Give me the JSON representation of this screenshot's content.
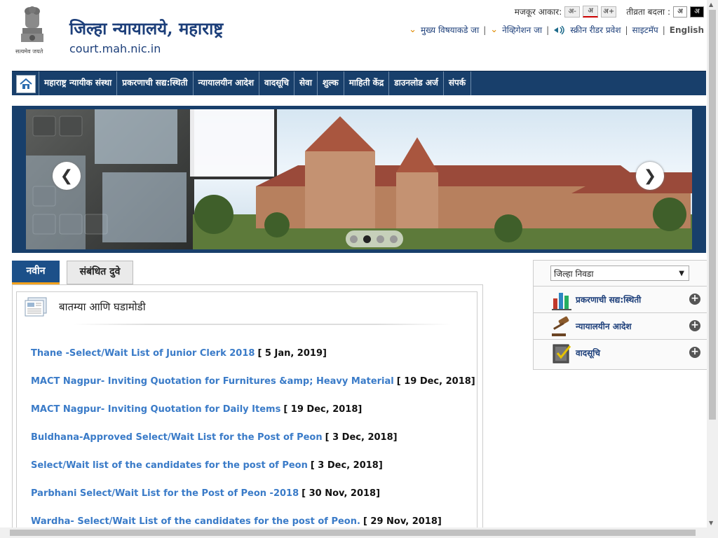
{
  "header": {
    "title": "जिल्हा न्यायालये, महाराष्ट्र",
    "url": "court.mah.nic.in",
    "emblem_caption": "सत्यमेव जयते",
    "text_size_label": "मजकूर आकार:",
    "text_sizes": [
      "अ-",
      "अ",
      "अ+"
    ],
    "contrast_label": "तीव्रता बदला :",
    "contrast_options": [
      "अ",
      "अ"
    ],
    "skip_to_main": "मुख्य विषयाकडे जा",
    "skip_to_nav": "नेव्हिगेशन जा",
    "screen_reader": "स्क्रीन रीडर प्रवेश",
    "sitemap": "साइटमॅप",
    "language": "English"
  },
  "nav": {
    "home_icon": "home-icon",
    "items": [
      "महाराष्ट्र न्यायीक संस्था",
      "प्रकरणाची सद्य:स्थिती",
      "न्यायालयीन आदेश",
      "वादसूचि",
      "सेवा",
      "शुल्क",
      "माहिती केंद्र",
      "डाउनलोड अर्ज",
      "संपर्क"
    ]
  },
  "slider": {
    "active_dot": 1,
    "dot_count": 4
  },
  "tabs": {
    "active": "नवीन",
    "inactive": "संबंधित दुवे"
  },
  "news": {
    "title": "बातम्या आणि घडामोडी",
    "items": [
      {
        "text": "Thane -Select/Wait List of Junior Clerk 2018",
        "date": "[ 5 Jan, 2019]"
      },
      {
        "text": "MACT Nagpur- Inviting Quotation for Furnitures &amp; Heavy Material",
        "date": "[ 19 Dec, 2018]"
      },
      {
        "text": "MACT Nagpur- Inviting Quotation for Daily Items",
        "date": "[ 19 Dec, 2018]"
      },
      {
        "text": "Buldhana-Approved Select/Wait List for the Post of Peon",
        "date": "[ 3 Dec, 2018]"
      },
      {
        "text": "Select/Wait list of the candidates for the post of Peon",
        "date": "[ 3 Dec, 2018]"
      },
      {
        "text": "Parbhani Select/Wait List for the Post of Peon -2018",
        "date": "[ 30 Nov, 2018]"
      },
      {
        "text": "Wardha- Select/Wait List of the candidates for the post of Peon.",
        "date": "[ 29 Nov, 2018]"
      }
    ]
  },
  "side": {
    "district_select": "जिल्हा निवडा",
    "rows": [
      {
        "label": "प्रकरणाची सद्य:स्थिती",
        "icon": "bar-chart-icon"
      },
      {
        "label": "न्यायालयीन आदेश",
        "icon": "gavel-icon"
      },
      {
        "label": "वादसूचि",
        "icon": "checklist-icon"
      }
    ]
  },
  "colors": {
    "nav_bg": "#183f6b",
    "link": "#3a7bc8",
    "tab_active": "#1c5089",
    "tab_underline": "#f3a21d"
  }
}
